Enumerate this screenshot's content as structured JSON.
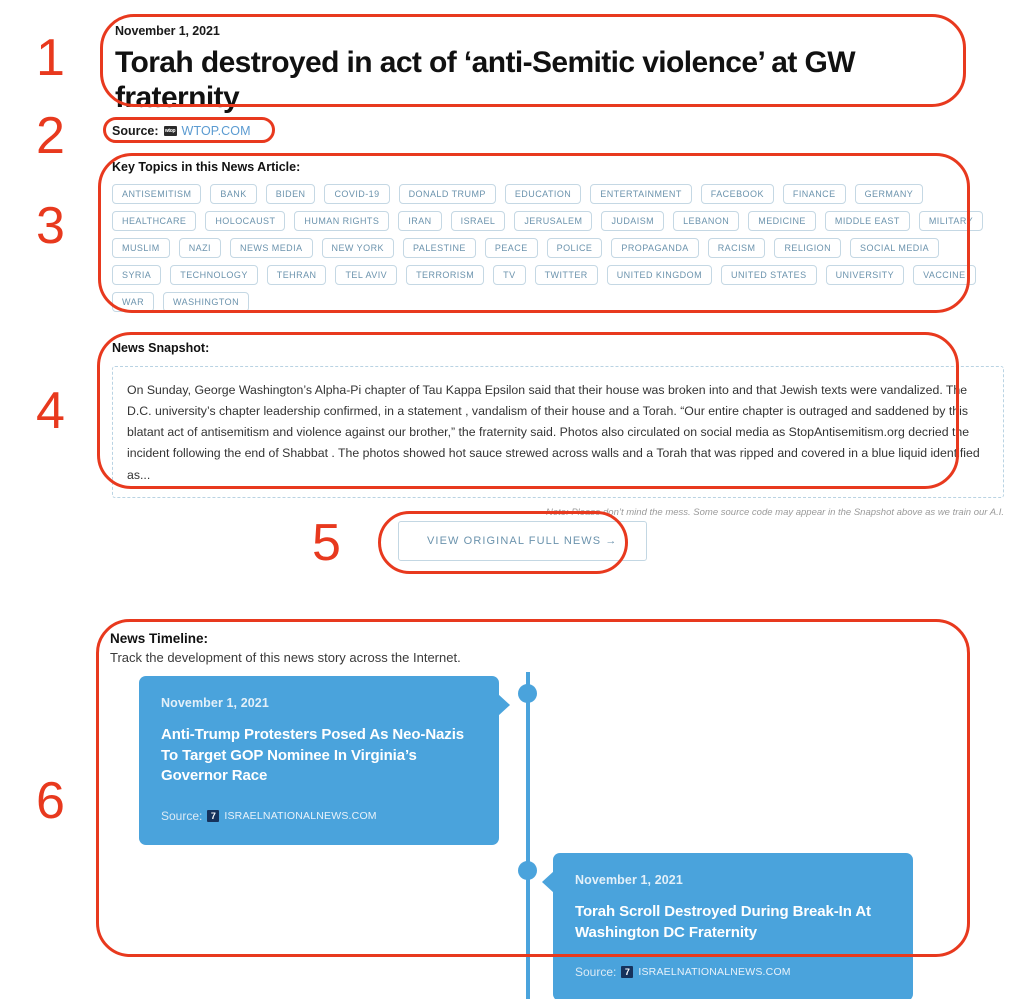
{
  "article": {
    "date": "November 1, 2021",
    "headline": "Torah destroyed in act of ‘anti-Semitic violence’ at GW fraternity",
    "source_label": "Source:",
    "source_favicon_text": "wtop",
    "source_name": "WTOP.COM"
  },
  "topics": {
    "label": "Key Topics in this News Article:",
    "items": [
      "ANTISEMITISM",
      "BANK",
      "BIDEN",
      "COVID-19",
      "DONALD TRUMP",
      "EDUCATION",
      "ENTERTAINMENT",
      "FACEBOOK",
      "FINANCE",
      "GERMANY",
      "HEALTHCARE",
      "HOLOCAUST",
      "HUMAN RIGHTS",
      "IRAN",
      "ISRAEL",
      "JERUSALEM",
      "JUDAISM",
      "LEBANON",
      "MEDICINE",
      "MIDDLE EAST",
      "MILITARY",
      "MUSLIM",
      "NAZI",
      "NEWS MEDIA",
      "NEW YORK",
      "PALESTINE",
      "PEACE",
      "POLICE",
      "PROPAGANDA",
      "RACISM",
      "RELIGION",
      "SOCIAL MEDIA",
      "SYRIA",
      "TECHNOLOGY",
      "TEHRAN",
      "TEL AVIV",
      "TERRORISM",
      "TV",
      "TWITTER",
      "UNITED KINGDOM",
      "UNITED STATES",
      "UNIVERSITY",
      "VACCINE",
      "WAR",
      "WASHINGTON"
    ]
  },
  "snapshot": {
    "label": "News Snapshot:",
    "text": "On Sunday, George Washington’s Alpha-Pi chapter of Tau Kappa Epsilon said that their house was broken into and that Jewish texts were vandalized. The D.C. university’s chapter leadership confirmed, in a statement , vandalism of their house and a Torah. “Our entire chapter is outraged and saddened by this blatant act of antisemitism and violence against our brother,” the fraternity said. Photos also circulated on social media as StopAntisemitism.org decried the incident following the end of Shabbat . The photos showed hot sauce strewed across walls and a Torah that was ripped and covered in a blue liquid identified as...",
    "note": "Note: Please don’t mind the mess. Some source code may appear in the Snapshot above as we train our A.I."
  },
  "cta": {
    "label": "VIEW ORIGINAL FULL NEWS →"
  },
  "timeline": {
    "title": "News Timeline:",
    "subtitle": "Track the development of this news story across the Internet.",
    "source_label": "Source:",
    "entries": [
      {
        "date": "November 1, 2021",
        "title": "Anti-Trump Protesters Posed As Neo-Nazis To Target GOP Nominee In Virginia’s Governor Race",
        "favicon_text": "7",
        "source_name": "ISRAELNATIONALNEWS.COM",
        "side": "left"
      },
      {
        "date": "November 1, 2021",
        "title": "Torah Scroll Destroyed During Break-In At Washington DC Fraternity",
        "favicon_text": "7",
        "source_name": "ISRAELNATIONALNEWS.COM",
        "side": "right"
      }
    ]
  },
  "annotations": {
    "color": "#E8391E",
    "numbers": [
      "1",
      "2",
      "3",
      "4",
      "5",
      "6"
    ]
  },
  "colors": {
    "accent_blue": "#4AA3DC",
    "tag_border": "#c5d8e4",
    "tag_text": "#6b93ad",
    "annotation_red": "#E8391E"
  }
}
